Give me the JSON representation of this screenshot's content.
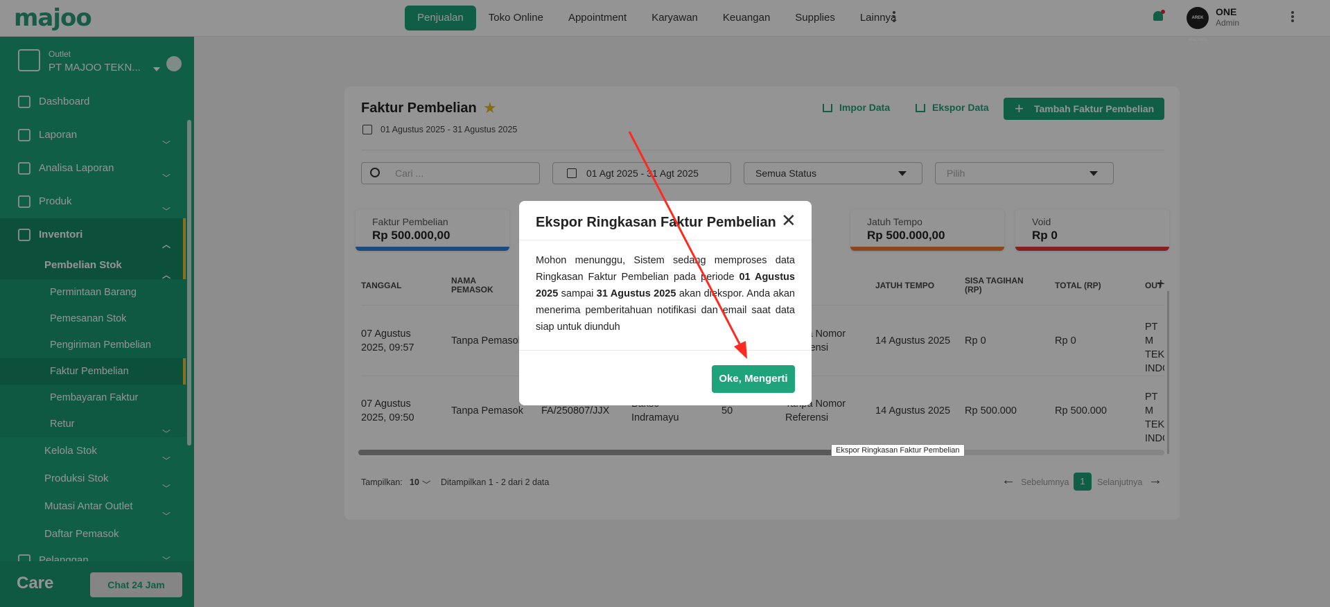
{
  "topbar": {
    "logo": "majoo",
    "nav": [
      "Penjualan",
      "Toko Online",
      "Appointment",
      "Karyawan",
      "Keuangan",
      "Supplies",
      "Lainnya"
    ],
    "avatar_text": "AREK MALANG",
    "user_name": "ONE",
    "user_role": "Admin"
  },
  "sidebar": {
    "outlet_label": "Outlet",
    "outlet_name": "PT MAJOO TEKN...",
    "items": [
      "Dashboard",
      "Laporan",
      "Analisa Laporan",
      "Produk",
      "Inventori",
      "Pembelian Stok",
      "Permintaan Barang",
      "Pemesanan Stok",
      "Pengiriman Pembelian",
      "Faktur Pembelian",
      "Pembayaran Faktur",
      "Retur",
      "Kelola Stok",
      "Produksi Stok",
      "Mutasi Antar Outlet",
      "Daftar Pemasok",
      "Pelanggan"
    ],
    "care_logo": "Care",
    "chat_button": "Chat 24 Jam"
  },
  "page": {
    "title": "Faktur Pembelian",
    "date_range": "01 Agustus 2025 - 31 Agustus 2025",
    "import_label": "Impor Data",
    "export_label": "Ekspor Data",
    "add_label": "Tambah Faktur Pembelian",
    "search_placeholder": "Cari ...",
    "date_filter": "01 Agt 2025 - 31 Agt 2025",
    "status_filter": "Semua Status",
    "pilih_filter": "Pilih"
  },
  "summary": [
    {
      "label": "Faktur Pembelian",
      "value": "Rp 500.000,00",
      "color": "#2f80d8"
    },
    {
      "label": "Jatuh Tempo",
      "value": "Rp 500.000,00",
      "color": "#f07a33"
    },
    {
      "label": "Void",
      "value": "Rp 0",
      "color": "#e23a3a"
    }
  ],
  "table": {
    "headers": [
      "TANGGAL",
      "NAMA PEMASOK",
      "JATUH TEMPO",
      "SISA TAGIHAN (RP)",
      "TOTAL (RP)",
      "OUT"
    ],
    "rows": [
      {
        "tanggal": "07 Agustus 2025, 09:57",
        "pemasok": "Tanpa Pemasok",
        "ref": "Tanpa Nomor Referensi",
        "jatuh_tempo": "14 Agustus 2025",
        "sisa": "Rp 0",
        "total": "Rp 0",
        "outlet": "PT M TEKN INDO"
      },
      {
        "tanggal": "07 Agustus 2025, 09:50",
        "pemasok": "Tanpa Pemasok",
        "no_faktur": "FA/250807/JJX",
        "outlet_name": "Bakso Indramayu",
        "qty": "50",
        "ref": "Tanpa Nomor Referensi",
        "jatuh_tempo": "14 Agustus 2025",
        "sisa": "Rp 500.000",
        "total": "Rp 500.000",
        "outlet": "PT M TEKN INDO"
      }
    ]
  },
  "footer": {
    "show_label": "Tampilkan:",
    "per_page": "10",
    "info": "Ditampilkan 1 - 2 dari 2 data",
    "prev": "Sebelumnya",
    "page": "1",
    "next": "Selanjutnya"
  },
  "modal": {
    "title": "Ekspor Ringkasan Faktur Pembelian",
    "body_1": "Mohon menunggu, Sistem sedang memproses data Ringkasan Faktur Pembelian pada periode ",
    "body_bold_1": "01 Agustus 2025",
    "body_2": " sampai ",
    "body_bold_2": "31 Agustus 2025",
    "body_3": " akan diekspor. Anda akan menerima pemberitahuan notifikasi dan email saat data siap untuk diunduh",
    "ok_button": "Oke, Mengerti"
  },
  "tooltip": "Ekspor Ringkasan Faktur Pembelian",
  "colors": {
    "brand": "#1ea37a",
    "annotation": "#ff2a1f",
    "star": "#e8b923"
  }
}
